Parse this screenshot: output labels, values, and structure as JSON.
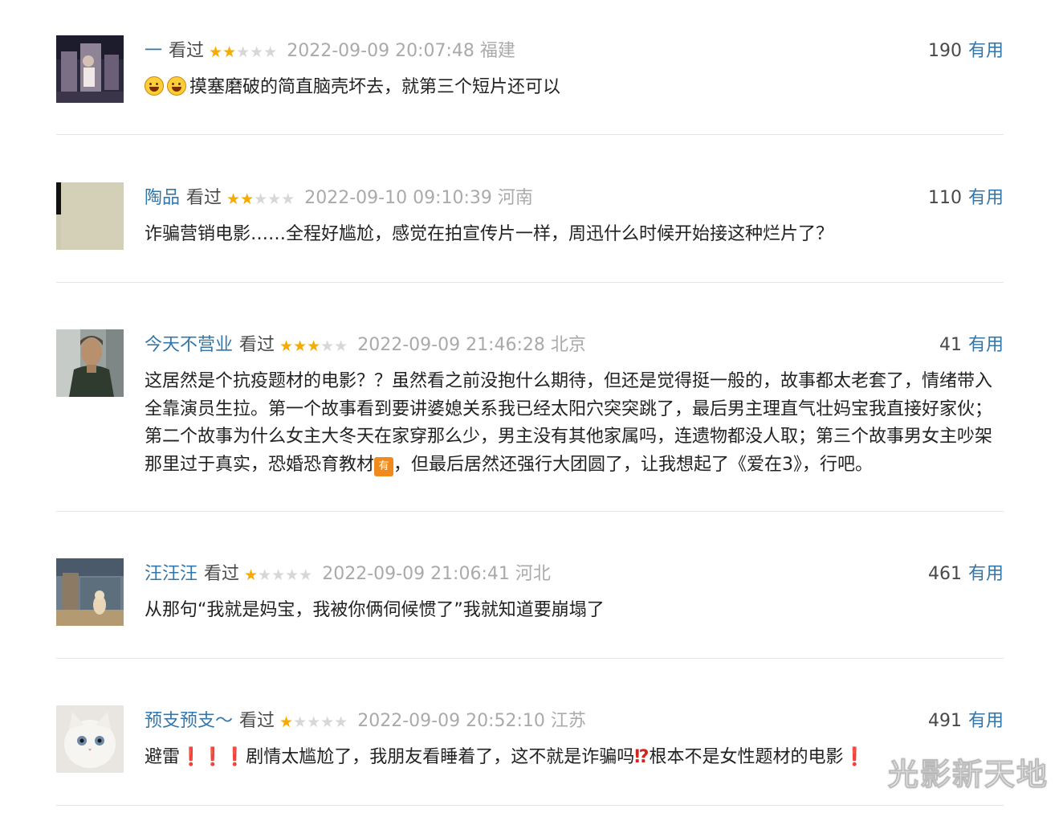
{
  "colors": {
    "username": "#3377aa",
    "useful_link": "#3377aa",
    "star_on": "#f6ab00",
    "star_off": "#d7d7d7",
    "timestamp": "#aaaaaa",
    "body_text": "#222222",
    "divider": "#e4e4e4"
  },
  "comments": [
    {
      "username": "一",
      "status": "看过",
      "rating": 2,
      "stars_on": "★★",
      "stars_off": "★★★",
      "timestamp": "2022-09-09 20:07:48",
      "location": "福建",
      "votes": "190",
      "useful_label": "有用",
      "avatar_icon": "avatar-photo-street",
      "content": "摸塞磨破的简直脑壳坏去，就第三个短片还可以"
    },
    {
      "username": "陶品",
      "status": "看过",
      "rating": 2,
      "stars_on": "★★",
      "stars_off": "★★★",
      "timestamp": "2022-09-10 09:10:39",
      "location": "河南",
      "votes": "110",
      "useful_label": "有用",
      "avatar_icon": "avatar-photo-wall",
      "content": "诈骗营销电影……全程好尴尬，感觉在拍宣传片一样，周迅什么时候开始接这种烂片了？"
    },
    {
      "username": "今天不营业",
      "status": "看过",
      "rating": 3,
      "stars_on": "★★★",
      "stars_off": "★★",
      "timestamp": "2022-09-09 21:46:28",
      "location": "北京",
      "votes": "41",
      "useful_label": "有用",
      "avatar_icon": "avatar-photo-man",
      "content_a": "这居然是个抗疫题材的电影？？虽然看之前没抱什么期待，但还是觉得挺一般的，故事都太老套了，情绪带入全靠演员生拉。第一个故事看到要讲婆媳关系我已经太阳穴突突跳了，最后男主理直气壮妈宝我直接好家伙；第二个故事为什么女主大冬天在家穿那么少，男主没有其他家属吗，连遗物都没人取；第三个故事男女主吵架那里过于真实，恐婚恐育教材",
      "badge": "有",
      "content_b": "，但最后居然还强行大团圆了，让我想起了《爱在3》，行吧。"
    },
    {
      "username": "汪汪汪",
      "status": "看过",
      "rating": 1,
      "stars_on": "★",
      "stars_off": "★★★★",
      "timestamp": "2022-09-09 21:06:41",
      "location": "河北",
      "votes": "461",
      "useful_label": "有用",
      "avatar_icon": "avatar-photo-hamster",
      "content": "从那句“我就是妈宝，我被你俩伺候惯了”我就知道要崩塌了"
    },
    {
      "username": "预支预支～",
      "status": "看过",
      "rating": 1,
      "stars_on": "★",
      "stars_off": "★★★★",
      "timestamp": "2022-09-09 20:52:10",
      "location": "江苏",
      "votes": "491",
      "useful_label": "有用",
      "avatar_icon": "avatar-photo-cat",
      "content_a": "避雷",
      "excl_a": "❗❗❗",
      "content_b": "剧情太尴尬了，我朋友看睡着了，这不就是诈骗吗",
      "excl_b": "⁉",
      "content_c": "根本不是女性题材的电影",
      "excl_c": "❗"
    }
  ],
  "watermark": "光影新天地"
}
